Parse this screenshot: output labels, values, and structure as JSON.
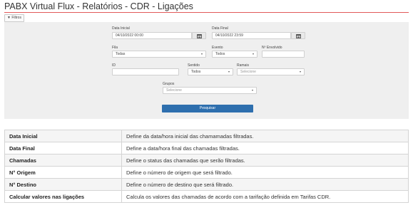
{
  "page": {
    "title": "PABX Virtual Flux - Relatórios - CDR - Ligações"
  },
  "filter_button": {
    "icon": "filter-icon",
    "label": "Filtros"
  },
  "form": {
    "data_inicial": {
      "label": "Data Inicial",
      "value": "04/10/2022 00:00"
    },
    "data_final": {
      "label": "Data Final",
      "value": "04/10/2022 23:59"
    },
    "fila": {
      "label": "Fila",
      "value": "Todas"
    },
    "evento": {
      "label": "Evento",
      "value": "Todos"
    },
    "numero_envolvido": {
      "label": "Nº Envolvido",
      "value": ""
    },
    "id": {
      "label": "ID",
      "value": ""
    },
    "sentido": {
      "label": "Sentido",
      "value": "Todos"
    },
    "ramais": {
      "label": "Ramais",
      "placeholder": "Selecione"
    },
    "grupos": {
      "label": "Grupos",
      "placeholder": "Selecione"
    },
    "submit_label": "Pesquisar"
  },
  "info_table": [
    {
      "field": "Data Inicial",
      "description": "Define da data/hora inicial das chamamadas filtradas."
    },
    {
      "field": "Data Final",
      "description": "Define a data/hora final das chamadas filtradas."
    },
    {
      "field": "Chamadas",
      "description": "Define o status das chamadas que serão filtradas."
    },
    {
      "field": "N° Origem",
      "description": "Define o número de origem que será filtrado."
    },
    {
      "field": "N° Destino",
      "description": "Define o número de destino que será filtrado."
    },
    {
      "field": "Calcular valores nas ligações",
      "description": "Calcula os valores das chamadas de acordo com a tarifação definida em Tarifas CDR."
    }
  ]
}
